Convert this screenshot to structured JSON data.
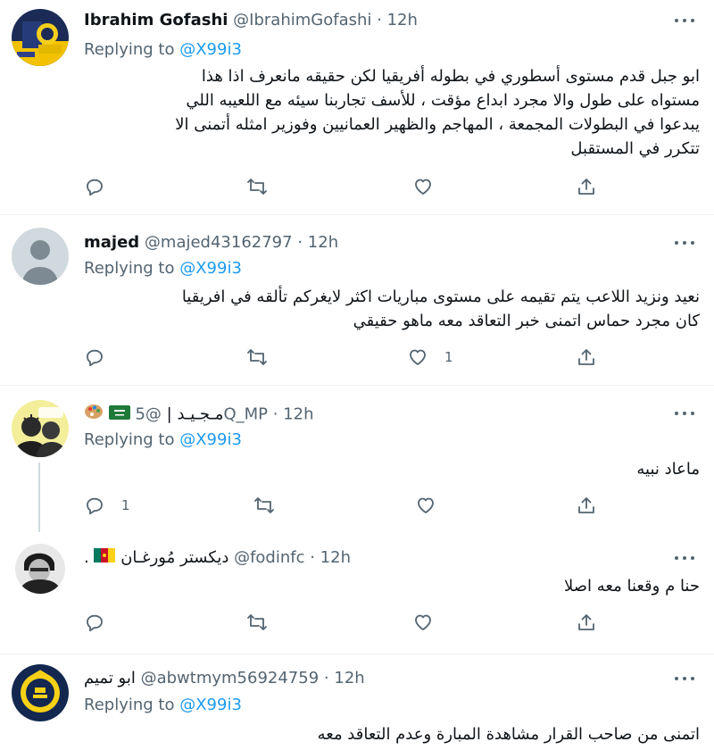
{
  "tweets": [
    {
      "name": "Ibrahim Gofashi",
      "handle": "@IbrahimGofashi",
      "sep": "·",
      "time": "12h",
      "replying_prefix": "Replying to",
      "replying_to": "@X99i3",
      "text_lines": [
        "ابو جبل قدم  مستوى أسطوري في بطوله أفريقيا  لكن حقيقه مانعرف اذا هذا",
        "مستواه على طول والا مجرد  ابداع مؤقت ،  للأسف تجاربنا سيئه مع اللعيبه اللي",
        "يبدعوا  في البطولات المجمعة  ، المهاجم والظهير العمانيين وفوزير امثله أتمنى الا",
        "تتكرر في المستقبل"
      ],
      "replies": "",
      "retweets": "",
      "likes": ""
    },
    {
      "name": "majed",
      "handle": "@majed43162797",
      "sep": "·",
      "time": "12h",
      "replying_prefix": "Replying to",
      "replying_to": "@X99i3",
      "text_lines": [
        "نعيد ونزيد اللاعب يتم تقيمه على مستوى مباريات اكثر لايغركم تألقه في افريقيا",
        "كان مجرد حماس اتمنى خبر التعاقد معه ماهو حقيقي"
      ],
      "replies": "",
      "retweets": "",
      "likes": "1"
    },
    {
      "name": "مـجـيـد",
      "name_suffix": "|",
      "handle": "@5Q_MP",
      "sep": "·",
      "time": "12h",
      "replying_prefix": "Replying to",
      "replying_to": "@X99i3",
      "text_lines": [
        "ماعاد نبيه"
      ],
      "replies": "1",
      "retweets": "",
      "likes": ""
    },
    {
      "name": "ديكستر مُورغـان",
      "name_suffix": ".",
      "handle": "@fodinfc",
      "sep": "·",
      "time": "12h",
      "text_lines": [
        "حنا م وقعنا معه اصلا"
      ],
      "replies": "",
      "retweets": "",
      "likes": ""
    },
    {
      "name": "ابو تميم",
      "handle": "@abwtmym56924759",
      "sep": "·",
      "time": "12h",
      "replying_prefix": "Replying to",
      "replying_to": "@X99i3",
      "text_lines": [
        "اتمنى من صاحب القرار مشاهدة المبارة وعدم التعاقد معه"
      ]
    }
  ],
  "colors": {
    "text": "#0f1419",
    "secondary": "#536471",
    "link": "#1d9bf0",
    "divider": "#eff3f4",
    "thread": "#cfd9de"
  },
  "icons": [
    "reply-icon",
    "retweet-icon",
    "like-icon",
    "share-icon",
    "more-icon"
  ]
}
